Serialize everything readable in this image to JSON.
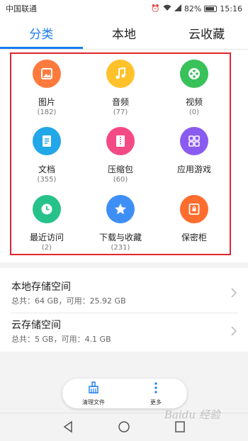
{
  "status_bar": {
    "carrier": "中国联通",
    "battery": "82%",
    "time": "15:16"
  },
  "tabs": [
    {
      "label": "分类",
      "active": true
    },
    {
      "label": "本地",
      "active": false
    },
    {
      "label": "云收藏",
      "active": false
    }
  ],
  "categories": [
    {
      "label": "图片",
      "count": "(182)",
      "icon": "image-icon",
      "color": "#ff7a3d"
    },
    {
      "label": "音频",
      "count": "(77)",
      "icon": "music-icon",
      "color": "#ffc22b"
    },
    {
      "label": "视频",
      "count": "(0)",
      "icon": "film-icon",
      "color": "#39c15a"
    },
    {
      "label": "文档",
      "count": "(355)",
      "icon": "document-icon",
      "color": "#22a7e8"
    },
    {
      "label": "压缩包",
      "count": "(60)",
      "icon": "zip-icon",
      "color": "#f34a86"
    },
    {
      "label": "应用游戏",
      "count": "",
      "icon": "apps-icon",
      "color": "#8a5bf0"
    },
    {
      "label": "最近访问",
      "count": "(2)",
      "icon": "clock-icon",
      "color": "#27c28a"
    },
    {
      "label": "下载与收藏",
      "count": "(231)",
      "icon": "star-icon",
      "color": "#3d8ff5"
    },
    {
      "label": "保密柜",
      "count": "",
      "icon": "safe-icon",
      "color": "#ff6d2e"
    }
  ],
  "storage": {
    "local": {
      "title": "本地存储空间",
      "detail": "总共：64 GB，可用：25.92 GB"
    },
    "cloud": {
      "title": "云存储空间",
      "detail": "总共：5 GB，可用：4.1 GB"
    }
  },
  "bottom_actions": {
    "clean": {
      "label": "清理文件",
      "icon": "broom-icon"
    },
    "more": {
      "label": "更多",
      "icon": "more-vertical-icon"
    }
  },
  "watermark": "Baidu 经验",
  "colors": {
    "accent": "#1a7cf0",
    "highlight_border": "#e0262f"
  }
}
